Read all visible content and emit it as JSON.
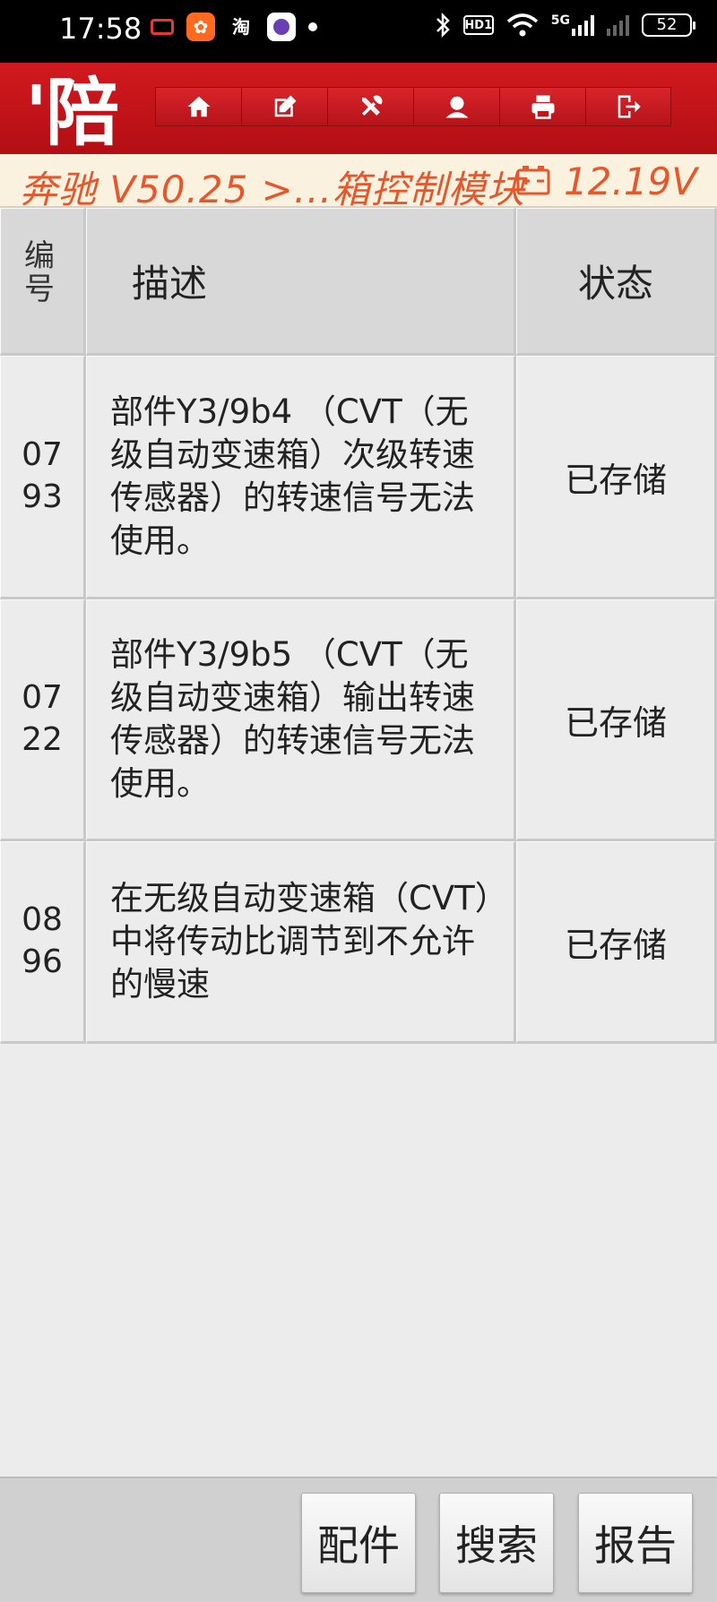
{
  "status_bar": {
    "time": "17:58",
    "app_icon_2_label": "淘",
    "hd_label": "HD1",
    "network_label": "5G",
    "battery": "52"
  },
  "header": {
    "logo_text": "'陪",
    "toolbar": [
      {
        "icon": "home-icon"
      },
      {
        "icon": "edit-icon"
      },
      {
        "icon": "tools-icon"
      },
      {
        "icon": "user-icon"
      },
      {
        "icon": "print-icon"
      },
      {
        "icon": "exit-icon"
      }
    ]
  },
  "breadcrumb": {
    "path": "奔驰 V50.25 >...箱控制模块",
    "voltage": "12.19V"
  },
  "table": {
    "headers": {
      "code": "编号",
      "description": "描述",
      "status": "状态"
    },
    "rows": [
      {
        "code": "0793",
        "description": "部件Y3/9b4 （CVT（无级自动变速箱）次级转速传感器）的转速信号无法使用。",
        "status": "已存储"
      },
      {
        "code": "0722",
        "description": "部件Y3/9b5 （CVT（无级自动变速箱）输出转速传感器）的转速信号无法使用。",
        "status": "已存储"
      },
      {
        "code": "0896",
        "description": "在无级自动变速箱（CVT）中将传动比调节到不允许的慢速",
        "status": "已存储"
      }
    ]
  },
  "bottom_bar": {
    "parts_label": "配件",
    "search_label": "搜索",
    "report_label": "报告"
  },
  "colors": {
    "header_red": "#c4141a",
    "breadcrumb_text": "#e8562c",
    "breadcrumb_bg": "#fbf1df"
  }
}
